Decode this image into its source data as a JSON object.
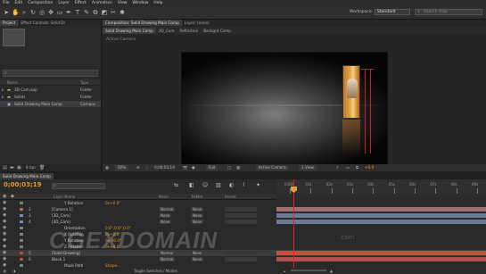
{
  "menu": [
    "File",
    "Edit",
    "Composition",
    "Layer",
    "Effect",
    "Animation",
    "View",
    "Window",
    "Help"
  ],
  "toolbar": {
    "workspace_label": "Workspace:",
    "workspace_value": "Standard",
    "search_placeholder": "Search Help",
    "tools": [
      "selection-tool",
      "hand-tool",
      "zoom-tool",
      "rotate-tool",
      "orbit-camera-tool",
      "pan-behind-tool",
      "rectangle-tool",
      "pen-tool",
      "type-tool",
      "brush-tool",
      "clone-tool",
      "eraser-tool",
      "roto-tool",
      "puppet-tool"
    ]
  },
  "project": {
    "tabs": [
      "Project",
      "Effect Controls: Solid Dr"
    ],
    "search_placeholder": "",
    "col_name": "Name",
    "col_type": "Type",
    "items": [
      {
        "name": "3D Cam.avp",
        "type": "Folder",
        "icon": "folder-icon",
        "selected": false
      },
      {
        "name": "Solids",
        "type": "Folder",
        "icon": "folder-icon",
        "selected": false
      },
      {
        "name": "Solid Drawing Main Comp",
        "type": "Compos",
        "icon": "composition-icon",
        "selected": true
      }
    ],
    "bpc": "8 bpc"
  },
  "comp_viewer": {
    "tabs": [
      "Composition: Solid Drawing Main Comp",
      "Layer: (none)"
    ],
    "subtabs": [
      "Solid Drawing Main Comp",
      "3D_Cam",
      "Reflection",
      "Backgrd Comp"
    ],
    "view_label": "Active Camera",
    "bottom": {
      "zoom": "50%",
      "timecode": "0;00;03;19",
      "resolution": "Full",
      "view": "Active Camera",
      "views": "1 View",
      "exposure": "+0.0"
    }
  },
  "timeline": {
    "tabs": [
      "Solid Drawing Main Comp"
    ],
    "timecode": "0;00;03;19",
    "col_headers": {
      "layer_name": "Layer Name",
      "mode": "Mode",
      "trkmat": "TrkMat",
      "parent": "Parent"
    },
    "ruler": [
      "0:00s",
      "01s",
      "02s",
      "03s",
      "04s",
      "05s",
      "06s",
      "07s",
      "08s",
      "09s"
    ],
    "rows": [
      {
        "num": "",
        "name": "Y Rotation",
        "value": "0x+0.0°",
        "color": "#808080"
      },
      {
        "num": "2",
        "name": "[Camera 1]",
        "value": "",
        "color": "#bf5f5f"
      },
      {
        "num": "3",
        "name": "[3D_Cam]",
        "value": "",
        "color": "#7f8fb0"
      },
      {
        "num": "4",
        "name": "[3D_Cam]",
        "value": "",
        "color": "#7f8fb0"
      },
      {
        "num": "",
        "name": "Orientation",
        "value": "0.0°,0.0°,0.0°",
        "color": "#808080"
      },
      {
        "num": "",
        "name": "X Rotation",
        "value": "0x+0.0°",
        "color": "#808080"
      },
      {
        "num": "",
        "name": "Y Rotation",
        "value": "0x-40.0°",
        "color": "#808080"
      },
      {
        "num": "",
        "name": "Z Rotation",
        "value": "0x+0.0°",
        "color": "#808080"
      },
      {
        "num": "5",
        "name": "[Solid Drawing]",
        "value": "",
        "color": "#c04c4c"
      },
      {
        "num": "6",
        "name": "Black 1",
        "value": "",
        "color": "#b45050"
      },
      {
        "num": "",
        "name": "Mask Path",
        "value": "Shape...",
        "color": "#808080"
      }
    ],
    "mode_values": [
      "Normal",
      "None",
      "None",
      "Normal",
      "Normal"
    ],
    "trkmat_value": "None",
    "toggle_label": "Toggle Switches / Modes"
  },
  "watermark": {
    "text": "CGEXDOMAIN",
    "subtext": ".com"
  }
}
